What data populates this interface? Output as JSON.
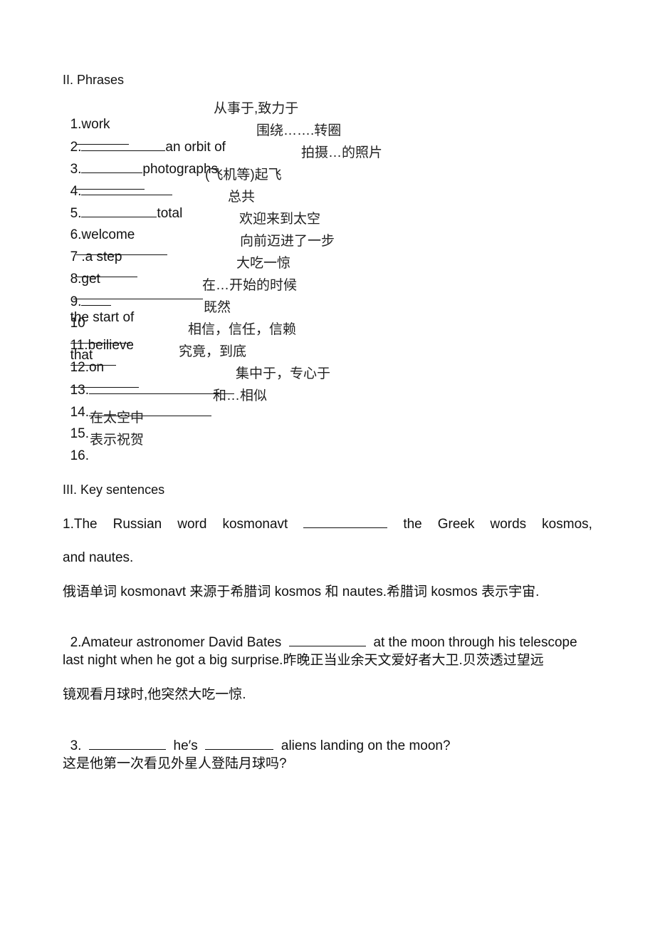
{
  "phrases": {
    "heading": "II. Phrases",
    "items": [
      {
        "pre": "1.work",
        "post": "",
        "cn": "从事于,致力于"
      },
      {
        "pre": "2.",
        "post": "an orbit of",
        "cn": "围绕…….转圈"
      },
      {
        "pre": "3.",
        "post": "photographs",
        "cn": "拍摄…的照片"
      },
      {
        "pre": "4.",
        "post": "",
        "cn": "(飞机等)起飞"
      },
      {
        "pre": "5.",
        "post": "total",
        "cn": "总共"
      },
      {
        "pre": "6.welcome",
        "post": "",
        "cn": "欢迎来到太空"
      },
      {
        "pre": "7 .a step",
        "post": "",
        "cn": "向前迈进了一步"
      },
      {
        "pre": "8.get",
        "post": "",
        "cn": "大吃一惊"
      },
      {
        "pre": "9.",
        "post": "the start of",
        "cn": "在…开始的时候"
      },
      {
        "pre": "10",
        "post": "that",
        "cn": "既然"
      },
      {
        "pre": "11.beilieve",
        "post": "",
        "cn": "相信，信任，信赖"
      },
      {
        "pre": "12.on",
        "post": "",
        "cn": "究竟，到底"
      },
      {
        "pre": "13.",
        "post": "",
        "cn": "集中于，专心于"
      },
      {
        "pre": "14.",
        "post": "",
        "cn": "和…相似"
      },
      {
        "pre": "15.",
        "post": "",
        "cn": "在太空中"
      },
      {
        "pre": "16.",
        "post": "",
        "cn": "表示祝贺"
      }
    ]
  },
  "sentences": {
    "heading": "III. Key sentences",
    "s1": {
      "words": [
        "1.The",
        "Russian",
        "word",
        "kosmonavt",
        "the",
        "Greek",
        "words",
        "kosmos,"
      ],
      "line2": "and nautes.",
      "cn": "俄语单词 kosmonavt 来源于希腊词 kosmos 和 nautes.希腊词 kosmos 表示宇宙."
    },
    "s2": {
      "pre": "2.Amateur astronomer David Bates",
      "post": "at the moon through his telescope",
      "line2": "last night when he got a big surprise.昨晚正当业余天文爱好者大卫.贝茨透过望远",
      "line3": "镜观看月球时,他突然大吃一惊."
    },
    "s3": {
      "pre": "3.",
      "mid": "he′s",
      "post": "aliens landing on the moon?",
      "cn": "这是他第一次看见外星人登陆月球吗?"
    }
  }
}
